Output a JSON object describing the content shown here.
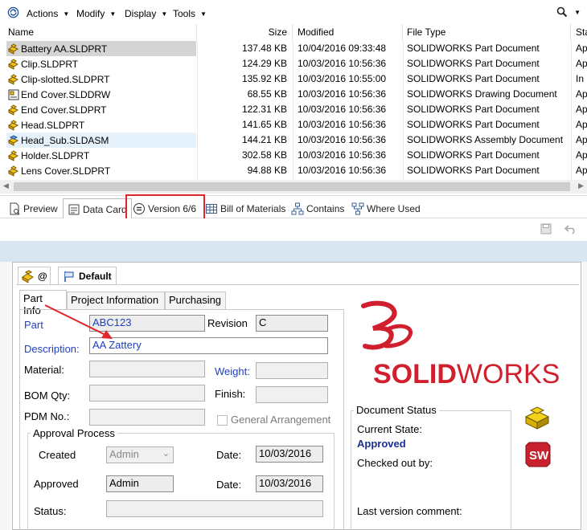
{
  "toolbar": {
    "menus": [
      {
        "label": "Actions"
      },
      {
        "label": "Modify"
      },
      {
        "label": "Display"
      },
      {
        "label": "Tools"
      }
    ]
  },
  "file_list": {
    "columns": {
      "name": "Name",
      "size": "Size",
      "modified": "Modified",
      "file_type": "File Type",
      "state": "Sta"
    },
    "rows": [
      {
        "name": "Battery AA.SLDPRT",
        "size": "137.48 KB",
        "modified": "10/04/2016 09:33:48",
        "type": "SOLIDWORKS Part Document",
        "state": "Ap",
        "icon": "part-icon"
      },
      {
        "name": "Clip.SLDPRT",
        "size": "124.29 KB",
        "modified": "10/03/2016 10:56:36",
        "type": "SOLIDWORKS Part Document",
        "state": "Ap",
        "icon": "part-icon"
      },
      {
        "name": "Clip-slotted.SLDPRT",
        "size": "135.92 KB",
        "modified": "10/03/2016 10:55:00",
        "type": "SOLIDWORKS Part Document",
        "state": "In",
        "icon": "part-icon"
      },
      {
        "name": "End Cover.SLDDRW",
        "size": "68.55 KB",
        "modified": "10/03/2016 10:56:36",
        "type": "SOLIDWORKS Drawing Document",
        "state": "Ap",
        "icon": "drawing-icon"
      },
      {
        "name": "End Cover.SLDPRT",
        "size": "122.31 KB",
        "modified": "10/03/2016 10:56:36",
        "type": "SOLIDWORKS Part Document",
        "state": "Ap",
        "icon": "part-icon"
      },
      {
        "name": "Head.SLDPRT",
        "size": "141.65 KB",
        "modified": "10/03/2016 10:56:36",
        "type": "SOLIDWORKS Part Document",
        "state": "Ap",
        "icon": "part-icon"
      },
      {
        "name": "Head_Sub.SLDASM",
        "size": "144.21 KB",
        "modified": "10/03/2016 10:56:36",
        "type": "SOLIDWORKS Assembly Document",
        "state": "Ap",
        "icon": "assembly-icon"
      },
      {
        "name": "Holder.SLDPRT",
        "size": "302.58 KB",
        "modified": "10/03/2016 10:56:36",
        "type": "SOLIDWORKS Part Document",
        "state": "Ap",
        "icon": "part-icon"
      },
      {
        "name": "Lens Cover.SLDPRT",
        "size": "94.88 KB",
        "modified": "10/03/2016 10:56:36",
        "type": "SOLIDWORKS Part Document",
        "state": "Ap",
        "icon": "part-icon"
      }
    ]
  },
  "bottom_tabs": [
    {
      "label": "Preview"
    },
    {
      "label": "Data Card"
    },
    {
      "label": "Version 6/6"
    },
    {
      "label": "Bill of Materials"
    },
    {
      "label": "Contains"
    },
    {
      "label": "Where Used"
    }
  ],
  "data_card": {
    "config_tabs": {
      "at": "@",
      "default": "Default"
    },
    "property_tabs": [
      "Part Info",
      "Project Information",
      "Purchasing"
    ],
    "fields": {
      "part_label": "Part",
      "part_value": "ABC123",
      "revision_label": "Revision",
      "revision_value": "C",
      "description_label": "Description:",
      "description_value": "AA Zattery",
      "material_label": "Material:",
      "material_value": "",
      "weight_label": "Weight:",
      "weight_value": "",
      "bom_label": "BOM Qty:",
      "bom_value": "",
      "finish_label": "Finish:",
      "finish_value": "",
      "pdm_label": "PDM No.:",
      "pdm_value": "",
      "general_arrangement_label": "General Arrangement"
    },
    "approval": {
      "title": "Approval Process",
      "created_label": "Created",
      "created_value": "Admin",
      "created_date_label": "Date:",
      "created_date_value": "10/03/2016",
      "approved_label": "Approved",
      "approved_value": "Admin",
      "approved_date_label": "Date:",
      "approved_date_value": "10/03/2016",
      "status_label": "Status:",
      "status_value": ""
    },
    "logo": {
      "text_bold": "SOLID",
      "text_light": "WORKS",
      "color": "#d0202e"
    },
    "document_status": {
      "title": "Document Status",
      "current_state_label": "Current State:",
      "current_state_value": "Approved",
      "checked_out_label": "Checked out by:",
      "last_comment_label": "Last version comment:"
    }
  },
  "colors": {
    "accent_blue": "#1f3fbf",
    "highlight_red": "#e0262b",
    "logo_red": "#d0202e"
  }
}
